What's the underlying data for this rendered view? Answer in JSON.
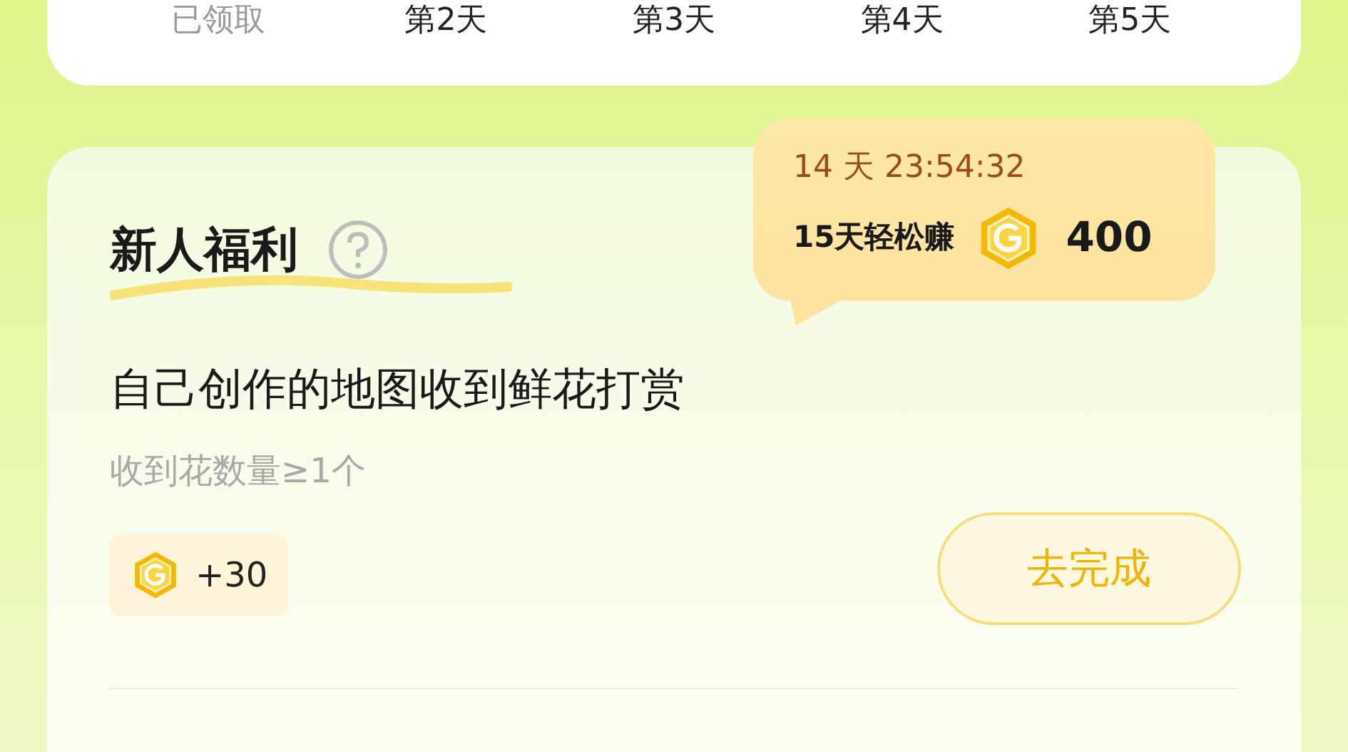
{
  "checkin_days": [
    {
      "label": "已领取",
      "claimed": true
    },
    {
      "label": "第2天",
      "claimed": false
    },
    {
      "label": "第3天",
      "claimed": false
    },
    {
      "label": "第4天",
      "claimed": false
    },
    {
      "label": "第5天",
      "claimed": false
    }
  ],
  "newcomer": {
    "title": "新人福利",
    "countdown": "14 天 23:54:32",
    "promo": "15天轻松赚",
    "promo_amount": "400",
    "tasks": [
      {
        "title": "自己创作的地图收到鲜花打赏",
        "requirement": "收到花数量≥1个",
        "reward": "+30",
        "action": "去完成"
      }
    ]
  }
}
